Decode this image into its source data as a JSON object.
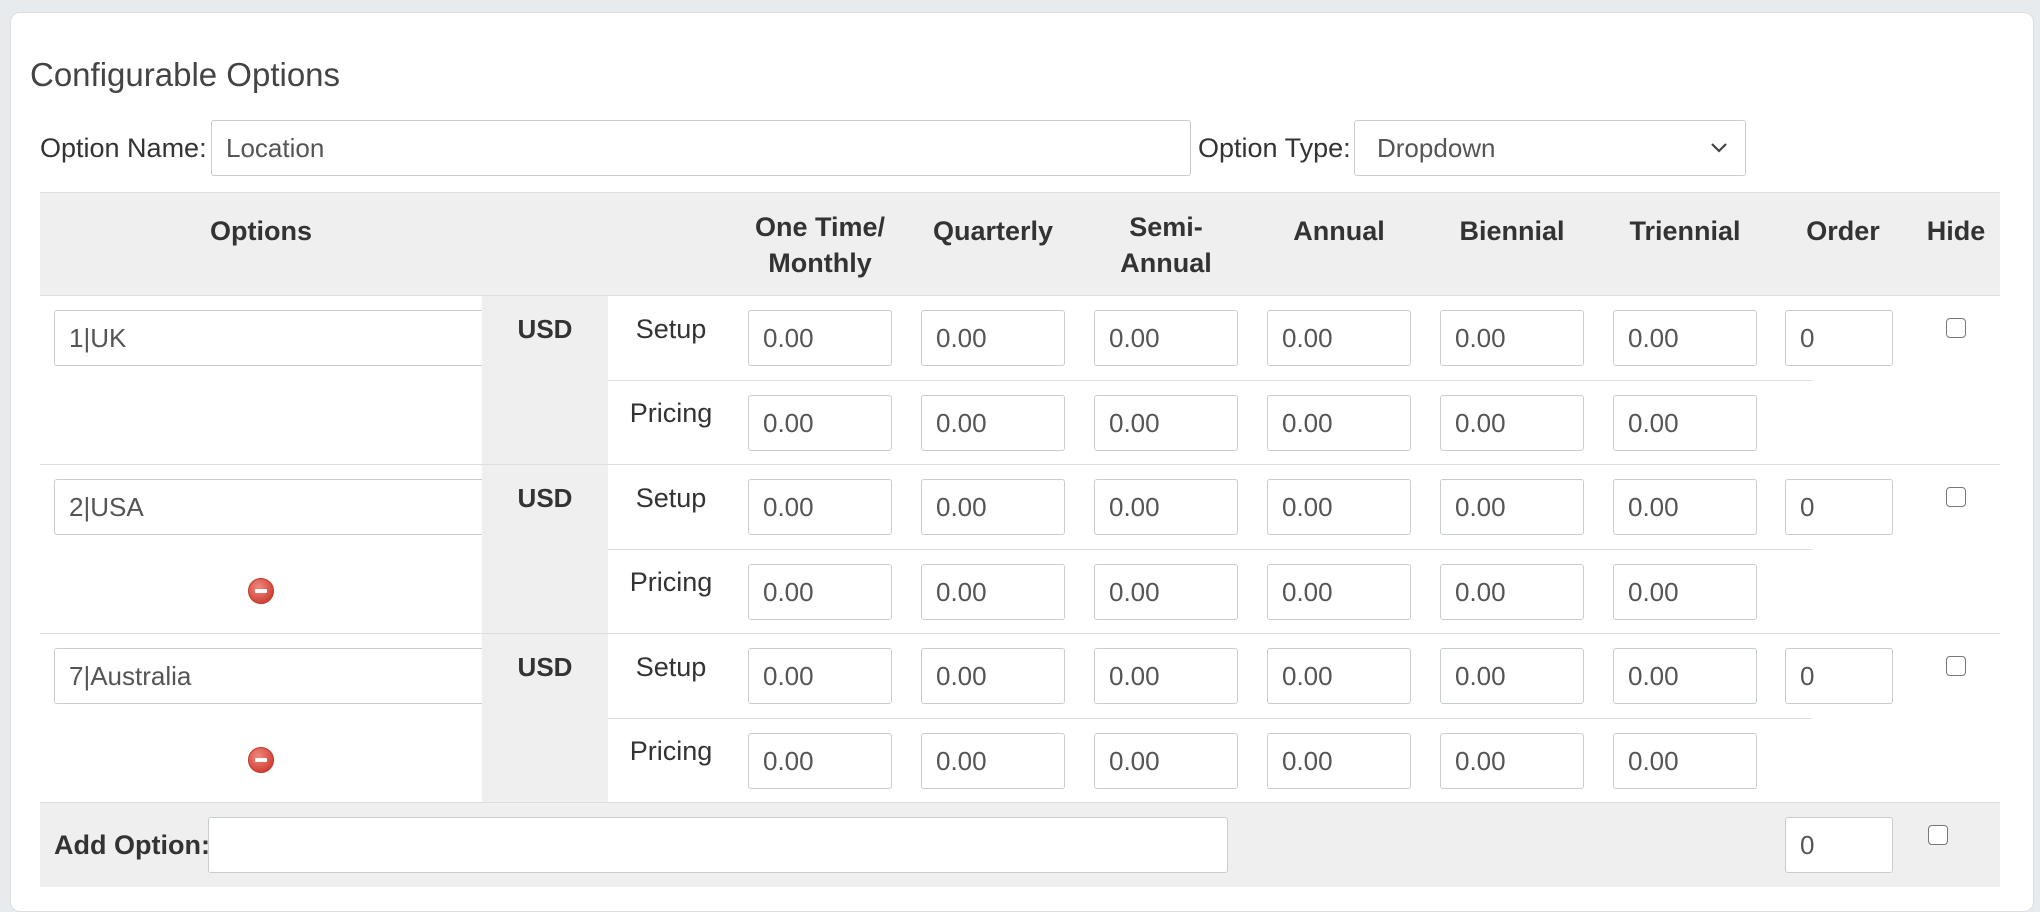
{
  "section": {
    "title": "Configurable Options"
  },
  "option_name": {
    "label": "Option Name:",
    "value": "Location"
  },
  "option_type": {
    "label": "Option Type:",
    "value": "Dropdown"
  },
  "table": {
    "headers": {
      "options": "Options",
      "monthly_line1": "One Time/",
      "monthly_line2": "Monthly",
      "quarterly": "Quarterly",
      "semi_line1": "Semi-",
      "semi_line2": "Annual",
      "annual": "Annual",
      "biennial": "Biennial",
      "triennial": "Triennial",
      "order": "Order",
      "hide": "Hide"
    },
    "rows": [
      {
        "name": "1|UK",
        "currency": "USD",
        "setup_label": "Setup",
        "pricing_label": "Pricing",
        "setup": [
          "0.00",
          "0.00",
          "0.00",
          "0.00",
          "0.00",
          "0.00"
        ],
        "pricing": [
          "0.00",
          "0.00",
          "0.00",
          "0.00",
          "0.00",
          "0.00"
        ],
        "order": "0",
        "removable": false
      },
      {
        "name": "2|USA",
        "currency": "USD",
        "setup_label": "Setup",
        "pricing_label": "Pricing",
        "setup": [
          "0.00",
          "0.00",
          "0.00",
          "0.00",
          "0.00",
          "0.00"
        ],
        "pricing": [
          "0.00",
          "0.00",
          "0.00",
          "0.00",
          "0.00",
          "0.00"
        ],
        "order": "0",
        "removable": true
      },
      {
        "name": "7|Australia",
        "currency": "USD",
        "setup_label": "Setup",
        "pricing_label": "Pricing",
        "setup": [
          "0.00",
          "0.00",
          "0.00",
          "0.00",
          "0.00",
          "0.00"
        ],
        "pricing": [
          "0.00",
          "0.00",
          "0.00",
          "0.00",
          "0.00",
          "0.00"
        ],
        "order": "0",
        "removable": true
      }
    ]
  },
  "add_option": {
    "label": "Add Option:",
    "value": "",
    "order": "0"
  },
  "icons": {
    "remove": "remove-circle-icon",
    "dropdown": "chevron-down-icon"
  },
  "colors": {
    "remove": "#d2453a",
    "header_bg": "#efefef"
  }
}
